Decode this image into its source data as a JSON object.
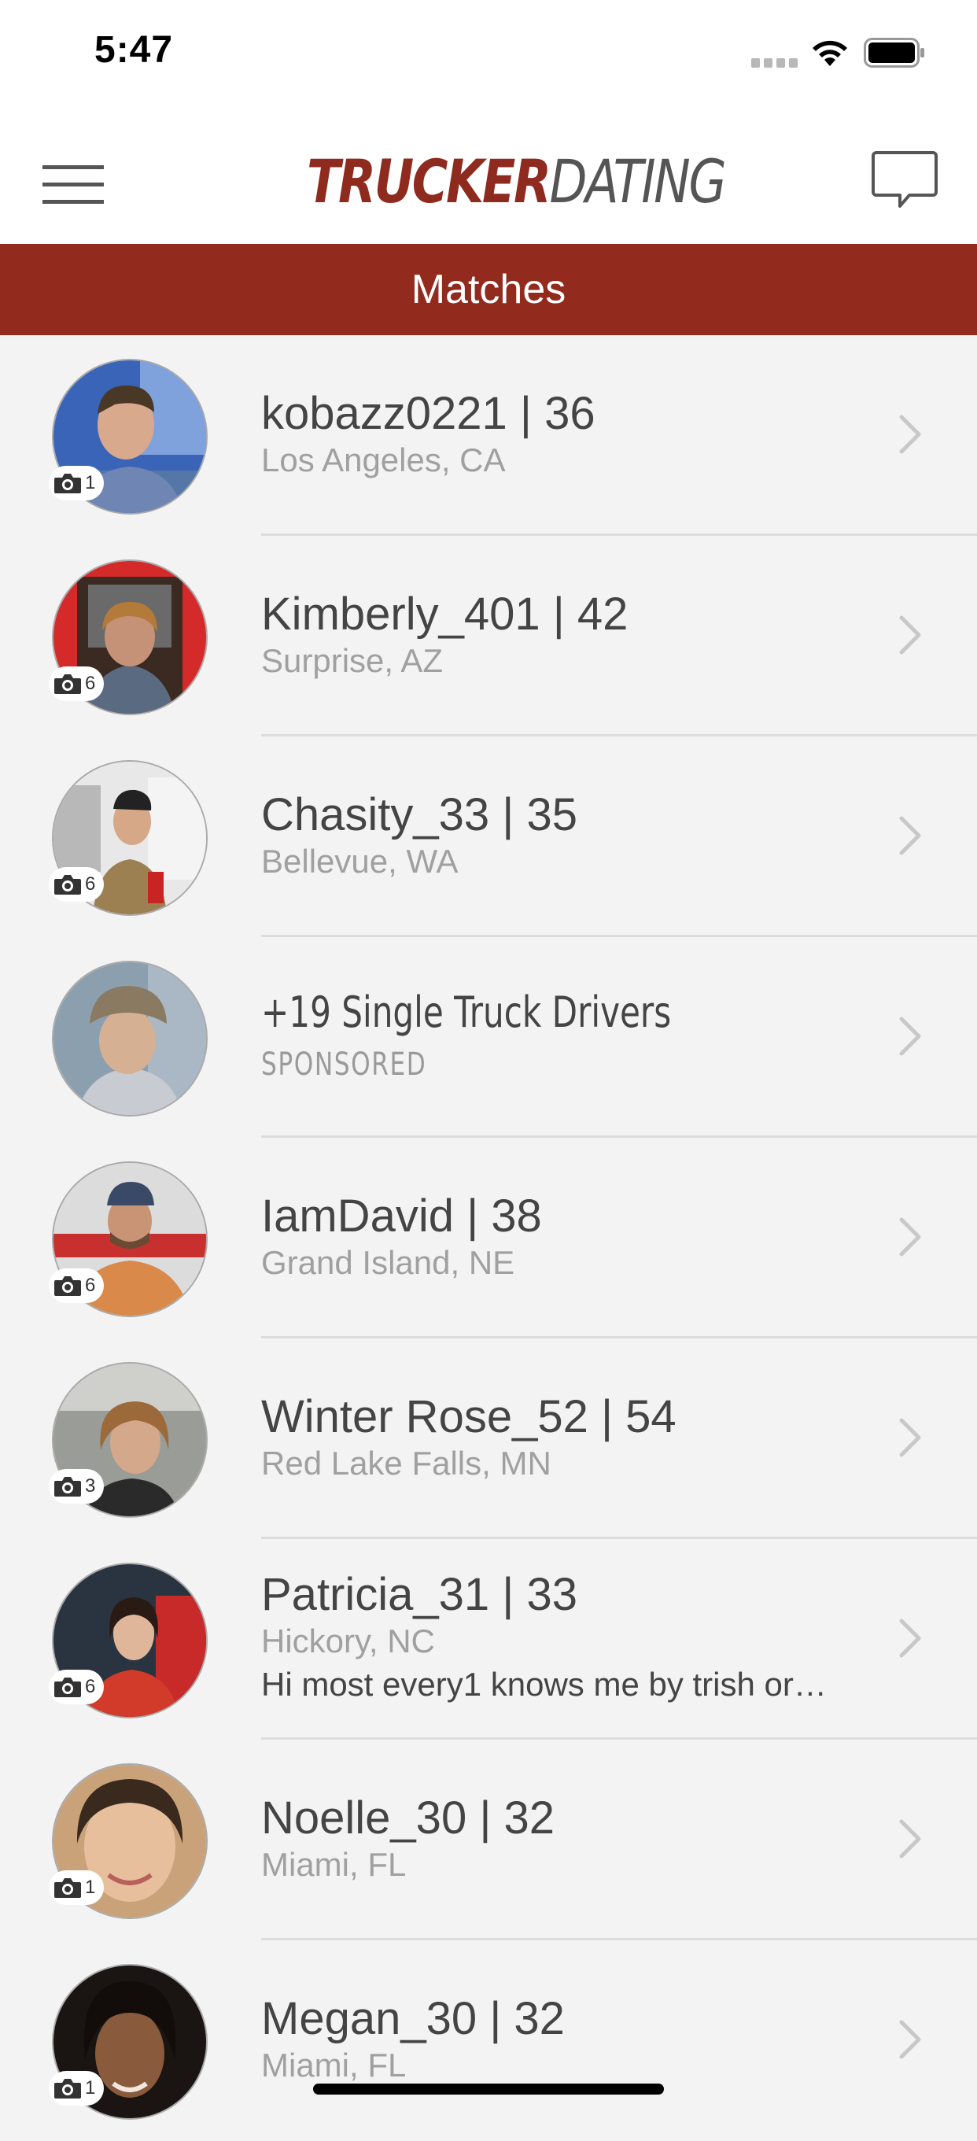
{
  "status_bar": {
    "time": "5:47"
  },
  "nav": {
    "logo_part1": "TRUCKER",
    "logo_part2": "DATING",
    "menu_icon": "hamburger-menu-icon",
    "chat_icon": "chat-bubble-icon"
  },
  "header": {
    "title": "Matches"
  },
  "colors": {
    "brand_red": "#922a1e",
    "text_dark": "#444444",
    "text_muted": "#a0a0a0"
  },
  "matches": [
    {
      "type": "profile",
      "name": "kobazz0221 | 36",
      "location": "Los Angeles, CA",
      "photos": "1"
    },
    {
      "type": "profile",
      "name": "Kimberly_401 | 42",
      "location": "Surprise, AZ",
      "photos": "6"
    },
    {
      "type": "profile",
      "name": "Chasity_33 | 35",
      "location": "Bellevue, WA",
      "photos": "6"
    },
    {
      "type": "sponsored",
      "name": "+19 Single Truck Drivers",
      "tag": "SPONSORED"
    },
    {
      "type": "profile",
      "name": "IamDavid | 38",
      "location": "Grand Island, NE",
      "photos": "6"
    },
    {
      "type": "profile",
      "name": "Winter Rose_52 | 54",
      "location": "Red Lake Falls, MN",
      "photos": "3"
    },
    {
      "type": "profile",
      "name": "Patricia_31 | 33",
      "location": "Hickory, NC",
      "snippet": "Hi most every1 knows me by trish or…",
      "photos": "6"
    },
    {
      "type": "profile",
      "name": "Noelle_30 | 32",
      "location": "Miami, FL",
      "photos": "1"
    },
    {
      "type": "profile",
      "name": "Megan_30 | 32",
      "location": "Miami, FL",
      "photos": "1"
    }
  ]
}
